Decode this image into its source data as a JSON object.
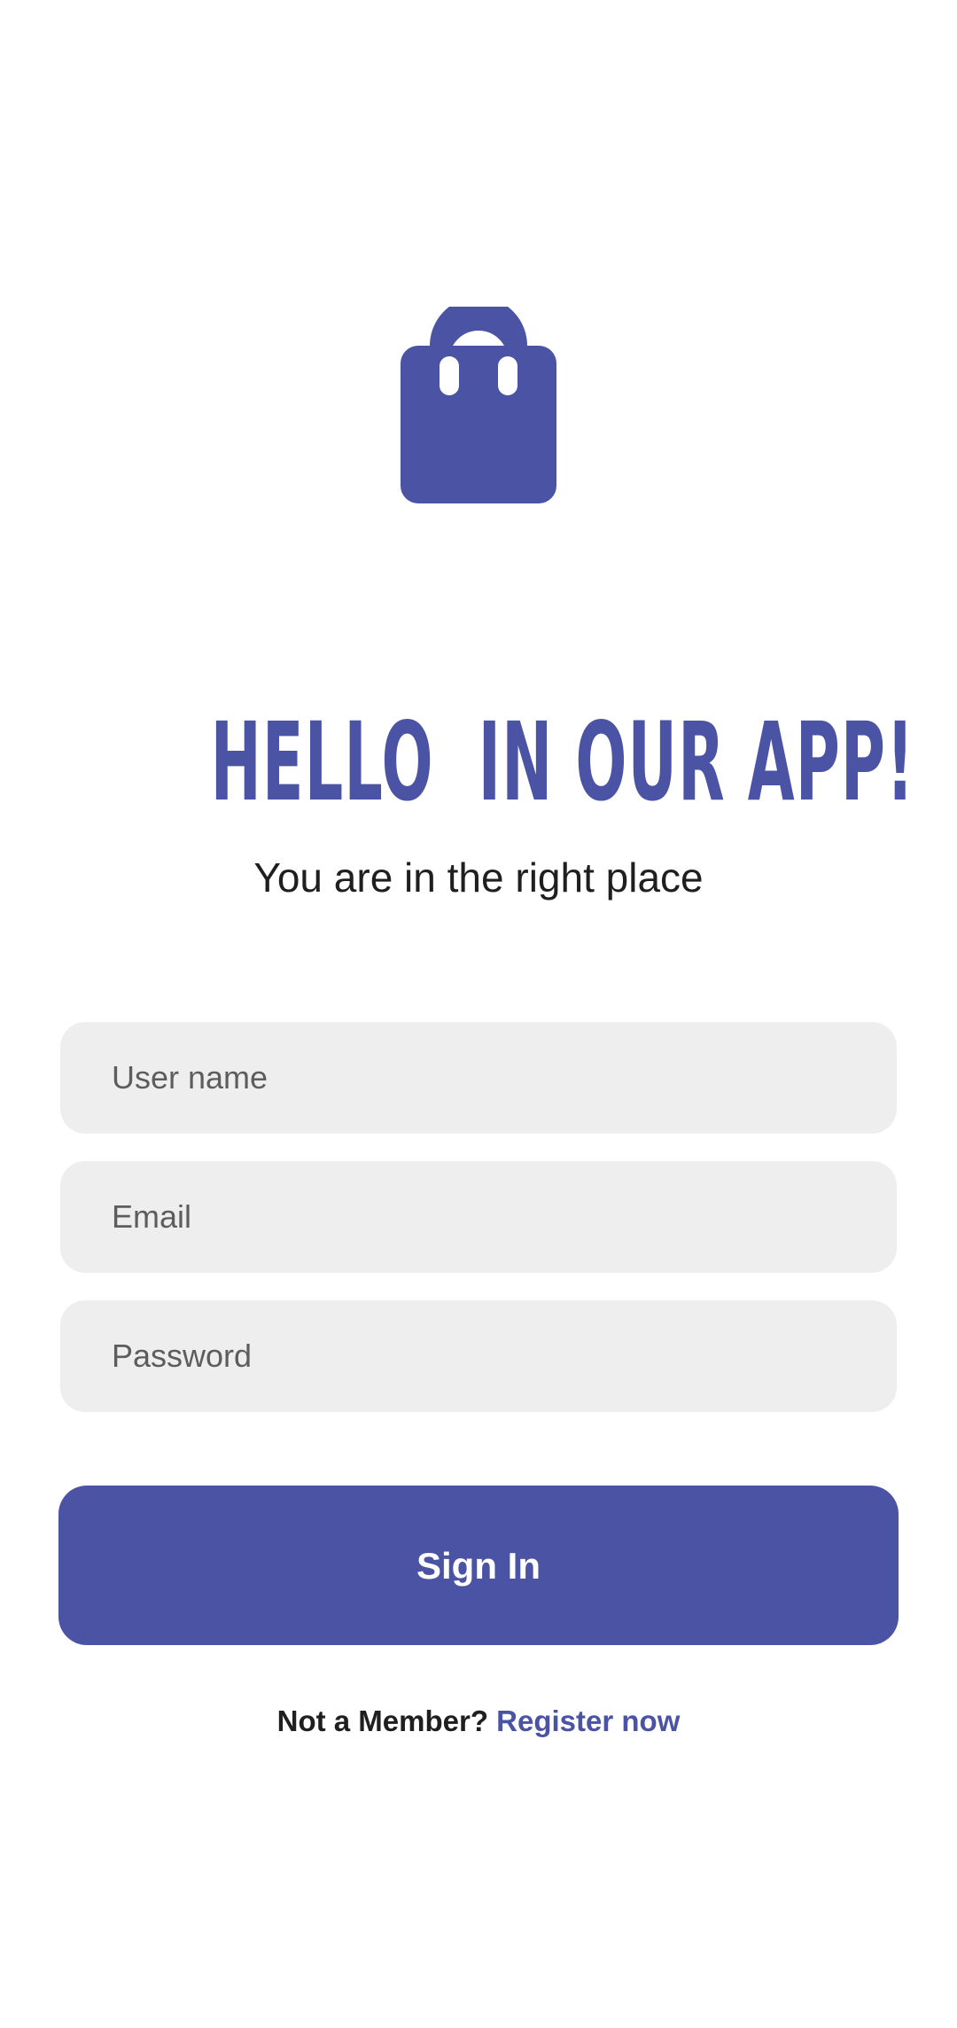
{
  "colors": {
    "accent": "#4b53a4",
    "field_bg": "#eeeeee",
    "text": "#1f1f1f",
    "placeholder": "#5d5d5d",
    "background": "#ffffff"
  },
  "logo": {
    "icon": "shopping-bag-icon"
  },
  "hero": {
    "title": "HELLO  IN OUR APP!",
    "subtitle": "You are in the right place"
  },
  "form": {
    "username_placeholder": "User name",
    "email_placeholder": "Email",
    "password_placeholder": "Password",
    "submit_label": "Sign In"
  },
  "footer": {
    "prompt": "Not a Member?",
    "link": "Register now"
  }
}
